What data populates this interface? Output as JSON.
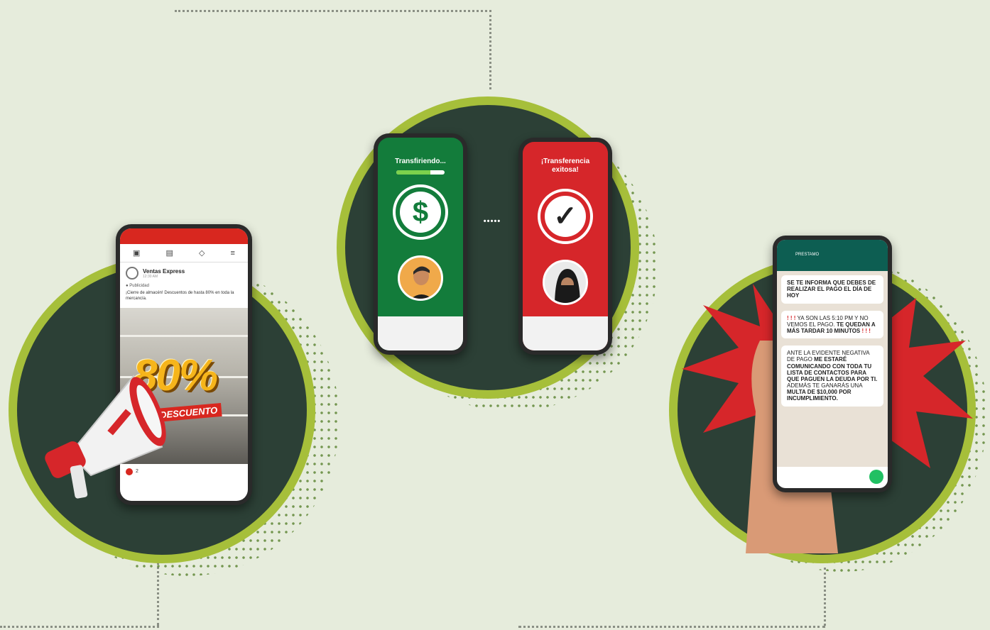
{
  "left_card": {
    "page_name": "Ventas Express",
    "post_time": "12:30 AM",
    "sponsored_label": "Publicidad",
    "post_text": "¡Cierre de almacén! Descuentos de hasta 80% en toda la mercancía.",
    "discount_value": "80%",
    "discount_label": "DESCUENTO",
    "likes_count": "2",
    "nav_icons": [
      "home-icon",
      "store-icon",
      "bell-icon",
      "menu-icon"
    ]
  },
  "middle_card": {
    "left_phone_title": "Transfiriendo...",
    "transfer_progress": 0.7,
    "left_phone_symbol": "$",
    "right_phone_title": "¡Transferencia exitosa!",
    "right_phone_symbol": "✓",
    "connector": "• • • • •"
  },
  "right_card": {
    "contact_name": "PRESTAMO",
    "message_1": "SE TE INFORMA QUE DEBES DE REALIZAR EL PAGO EL DÍA DE HOY",
    "message_2_alert": "! ! !",
    "message_2_plain": "YA SON LAS 5:10 PM Y NO VEMOS EL PAGO.",
    "message_2_bold": "TE QUEDAN A MÁS TARDAR 10 MINUTOS",
    "message_2_alert_end": "! ! !",
    "message_3_plain": "ANTE LA EVIDENTE NEGATIVA DE PAGO",
    "message_3_bold": "ME ESTARÉ COMUNICANDO CON TODA TU LISTA DE CONTACTOS PARA QUE PAGUEN LA DEUDA POR TI.",
    "message_3_plain_2": "ADEMÁS TE GANARÁS UNA",
    "message_3_bold_2": "MULTA DE $10,000 POR INCUMPLIMIENTO."
  },
  "colors": {
    "background": "#e6ecdc",
    "circle_fill": "#2c4036",
    "circle_border": "#a6bf3a",
    "red": "#d6262a",
    "green": "#137c3b"
  }
}
